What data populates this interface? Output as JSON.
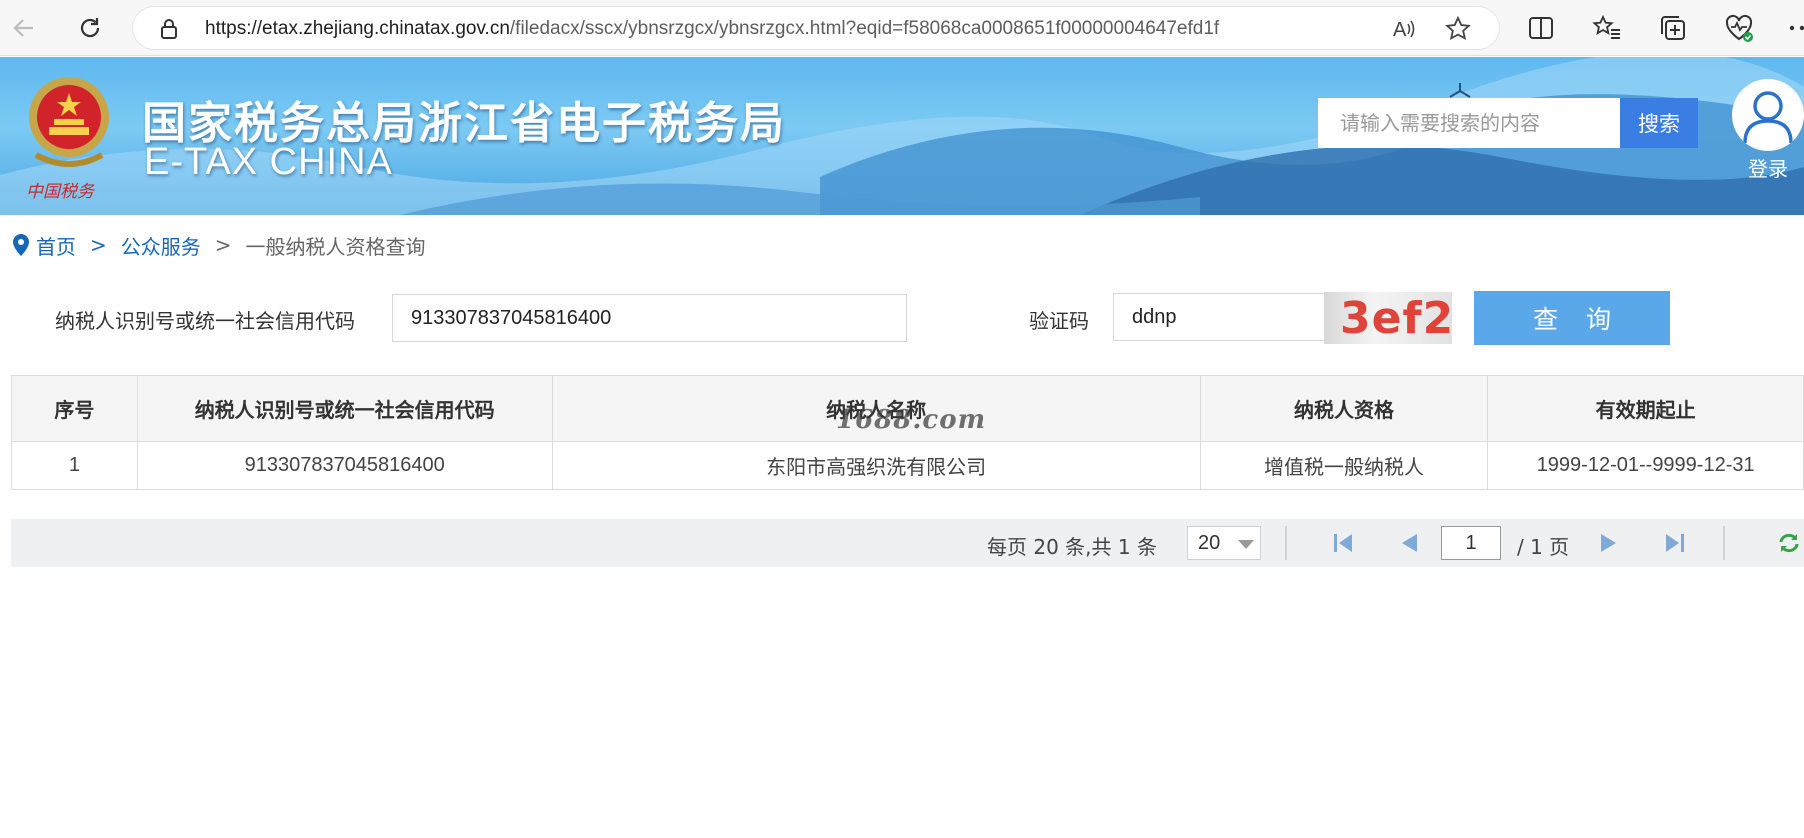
{
  "browser": {
    "url_domain": "https://etax.zhejiang.chinatax.gov.cn",
    "url_path": "/filedacx/sscx/ybnsrzgcx/ybnsrzgcx.html?eqid=f58068ca0008651f00000004647efd1f"
  },
  "header": {
    "title": "国家税务总局浙江省电子税务局",
    "subtitle": "E-TAX CHINA",
    "emblem_text": "中国税务",
    "search_placeholder": "请输入需要搜索的内容",
    "search_button": "搜索",
    "login_label": "登录"
  },
  "breadcrumb": {
    "home": "首页",
    "separator": ">",
    "section": "公众服务",
    "current": "一般纳税人资格查询"
  },
  "form": {
    "taxpayer_id_label": "纳税人识别号或统一社会信用代码",
    "taxpayer_id_value": "913307837045816400",
    "captcha_label": "验证码",
    "captcha_value": "ddnp",
    "captcha_image_text": "3ef2",
    "query_button": "查 询"
  },
  "table": {
    "columns": [
      "序号",
      "纳税人识别号或统一社会信用代码",
      "纳税人名称",
      "纳税人资格",
      "有效期起止"
    ],
    "rows": [
      [
        "1",
        "913307837045816400",
        "东阳市高强织洗有限公司",
        "增值税一般纳税人",
        "1999-12-01--9999-12-31"
      ]
    ]
  },
  "watermark": "1688.com",
  "pager": {
    "info": "每页 20 条,共 1 条",
    "page_size": "20",
    "current_page": "1",
    "total": "/ 1 页"
  },
  "colors": {
    "banner": "#5fb8ee",
    "search_button": "#3a7ee3",
    "query_button": "#5aa7ea",
    "link": "#1767b8"
  }
}
